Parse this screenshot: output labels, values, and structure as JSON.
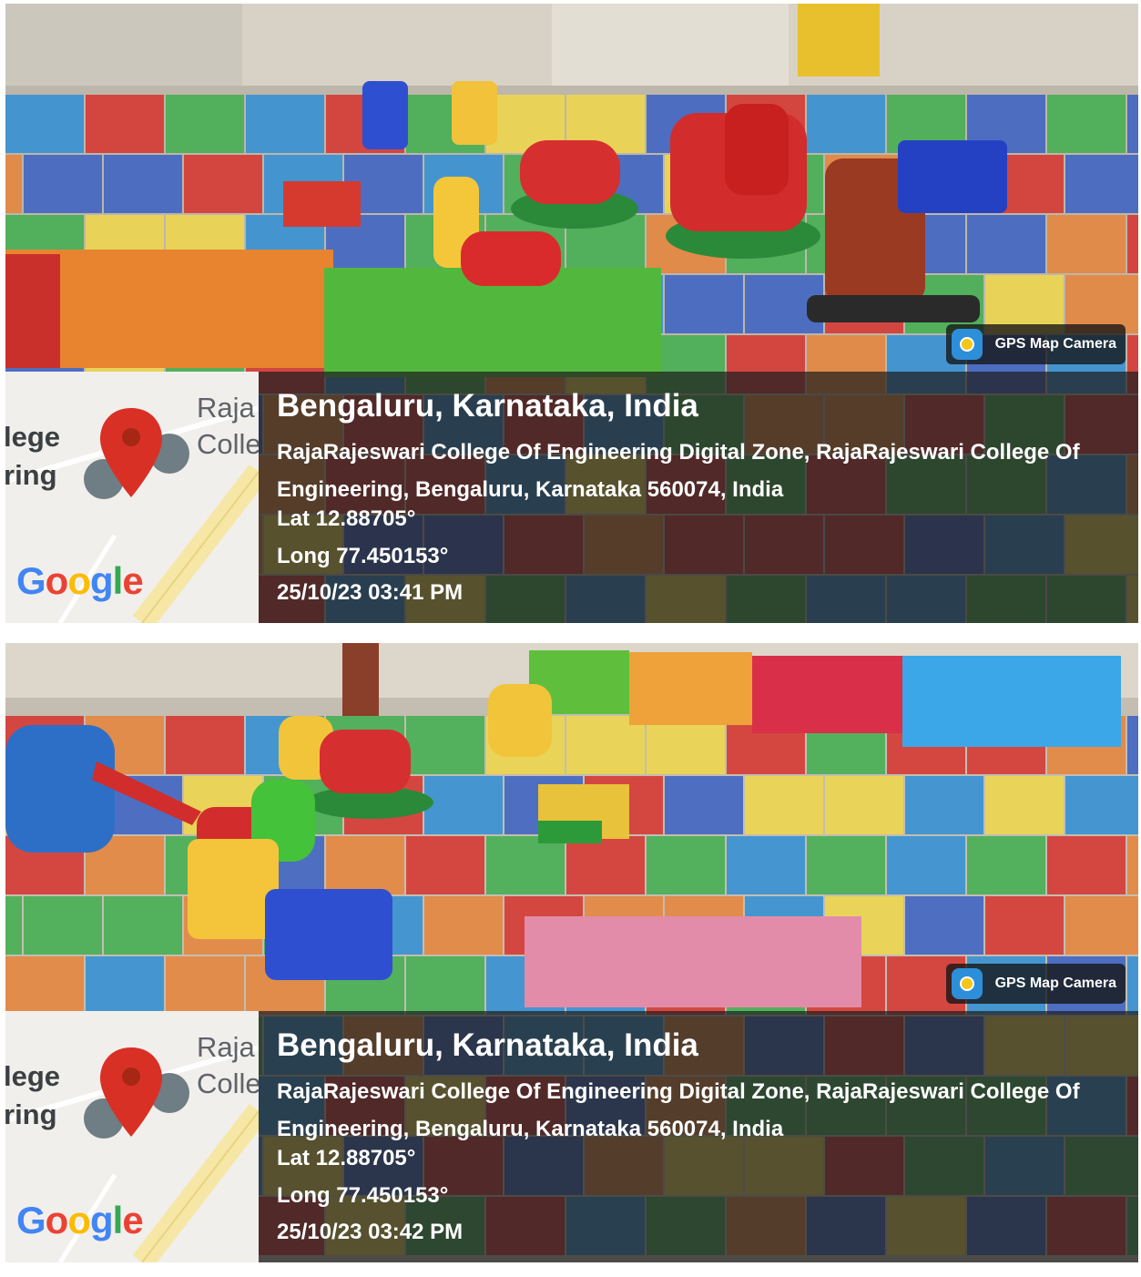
{
  "photos": [
    {
      "map": {
        "label_left_top": "lege",
        "label_left_bottom": "ring",
        "label_right_top": "Raja",
        "label_right_bottom": "Colle",
        "logo": "Google",
        "pin_icon": "map-pin-icon",
        "poi_icon": "school-poi-icon"
      },
      "badge": "GPS Map Camera",
      "city": "Bengaluru, Karnataka, India",
      "address": "RajaRajeswari College Of Engineering Digital Zone, RajaRajeswari College Of Engineering, Bengaluru, Karnataka 560074, India",
      "lat": "Lat 12.88705°",
      "long": "Long 77.450153°",
      "datetime": "25/10/23 03:41 PM"
    },
    {
      "map": {
        "label_left_top": "lege",
        "label_left_bottom": "ring",
        "label_right_top": "Raja",
        "label_right_bottom": "Colle",
        "logo": "Google",
        "pin_icon": "map-pin-icon",
        "poi_icon": "school-poi-icon"
      },
      "badge": "GPS Map Camera",
      "city": "Bengaluru, Karnataka, India",
      "address": "RajaRajeswari College Of Engineering Digital Zone, RajaRajeswari College Of Engineering, Bengaluru, Karnataka 560074, India",
      "lat": "Lat 12.88705°",
      "long": "Long 77.450153°",
      "datetime": "25/10/23 03:42 PM"
    }
  ],
  "colors": {
    "mat": [
      "#d7322e",
      "#3a62c4",
      "#3fae4f",
      "#f0d84a",
      "#e6843a",
      "#2f8fd6"
    ],
    "overlay": "#1e1e1e",
    "google": [
      "#4285f4",
      "#ea4335",
      "#fbbc05",
      "#4285f4",
      "#34a853",
      "#ea4335"
    ],
    "pin": "#d93025"
  }
}
